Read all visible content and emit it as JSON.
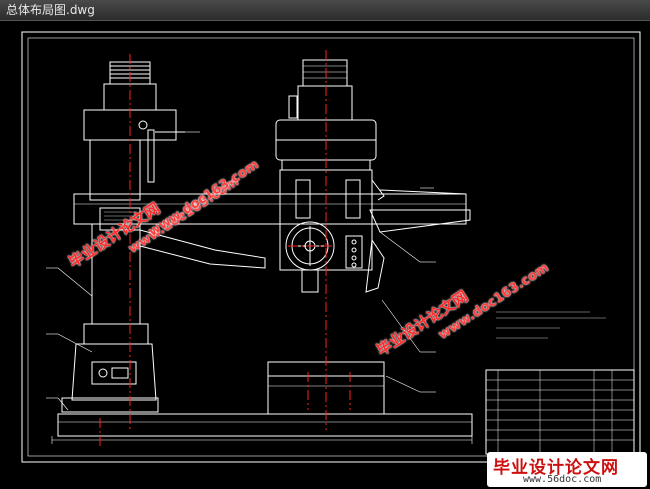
{
  "window": {
    "title": "总体布局图.dwg"
  },
  "colors": {
    "background": "#000000",
    "drawing_lines": "#ffffff",
    "centerlines": "#ff2020",
    "watermark": "#ff2a2a"
  },
  "watermarks": [
    {
      "cn": "毕业设计论文网",
      "url": "www.doc163.com"
    },
    {
      "cn": "毕业设计论文网",
      "url": "www.doc163.com"
    },
    {
      "cn": "毕业设计论文网",
      "url": "www.doc163.com"
    }
  ],
  "badge": {
    "cn": "毕业设计论文网",
    "url": "www.56doc.com"
  }
}
